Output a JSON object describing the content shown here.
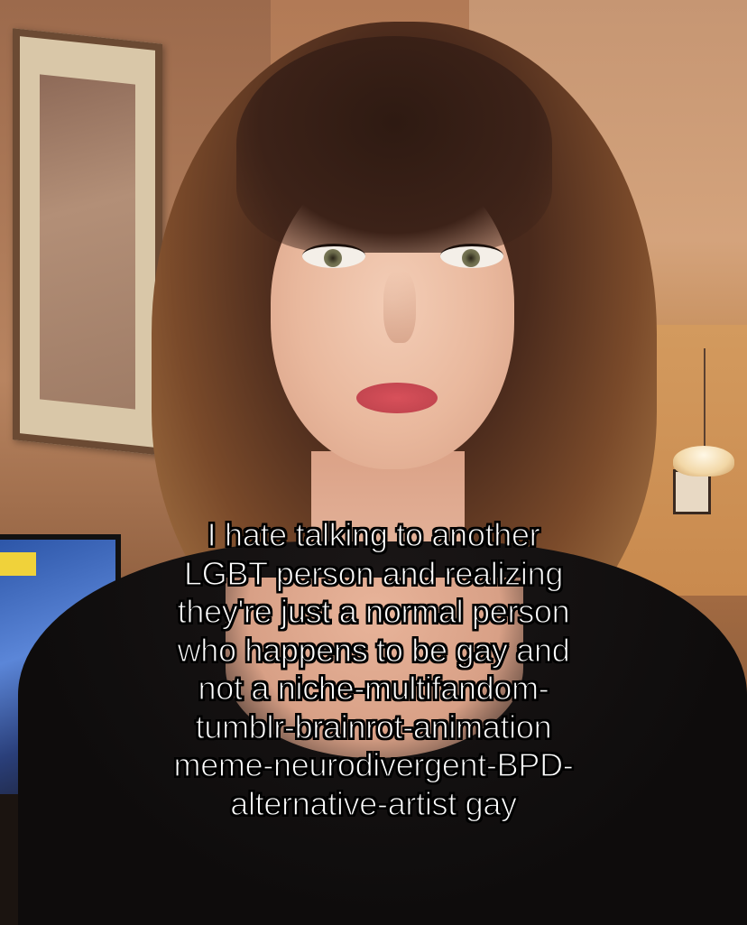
{
  "caption": {
    "lines": [
      "I hate talking to another",
      "LGBT person and realizing",
      "they're just a normal person",
      "who happens to be gay and",
      "not a niche-multifandom-",
      "tumblr-brainrot-animation",
      "meme-neurodivergent-BPD-",
      "alternative-artist gay"
    ]
  },
  "colors": {
    "caption_text": "#ffffff",
    "caption_outline": "#000000"
  }
}
